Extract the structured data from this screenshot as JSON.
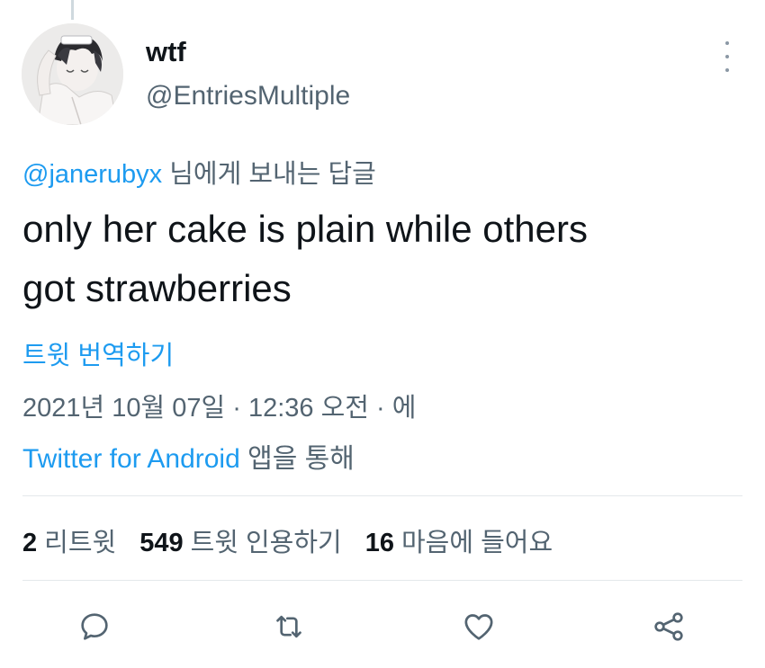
{
  "author": {
    "display_name": "wtf",
    "handle": "@EntriesMultiple"
  },
  "reply": {
    "mention": "@janerubyx",
    "suffix": "님에게 보내는 답글"
  },
  "tweet": {
    "text_line1": "only her cake is plain while others",
    "text_line2": "got strawberries",
    "translate_label": "트윗 번역하기"
  },
  "meta": {
    "timestamp": "2021년 10월 07일 · 12:36 오전 · 에",
    "source_app": "Twitter for Android",
    "source_suffix": "앱을 통해"
  },
  "stats": {
    "retweets": {
      "count": "2",
      "label": "리트윗"
    },
    "quotes": {
      "count": "549",
      "label": "트윗 인용하기"
    },
    "likes": {
      "count": "16",
      "label": "마음에 들어요"
    }
  },
  "icons": {
    "reply": "comment-icon",
    "retweet": "retweet-icon",
    "like": "heart-icon",
    "share": "share-icon",
    "more": "more-icon"
  },
  "colors": {
    "accent": "#1d9bf0",
    "secondary_text": "#536471",
    "primary_text": "#0f1419",
    "divider": "#e4e8eb"
  }
}
